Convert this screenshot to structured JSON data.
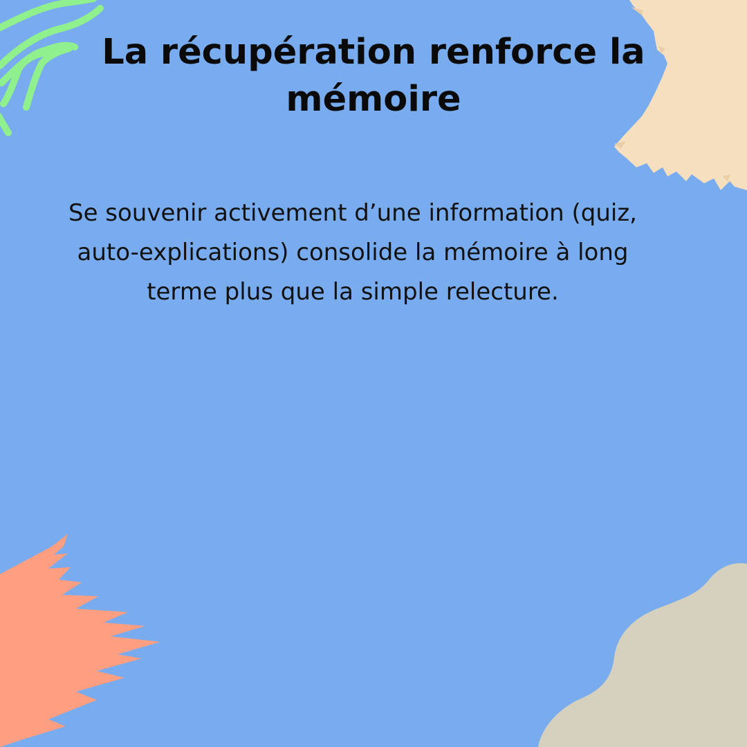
{
  "colors": {
    "background": "#78acee",
    "green_lines": "#8ff08d",
    "peach_brush": "#f5dfbe",
    "salmon_brush": "#ff9e80",
    "beige_blob": "#d6d0be",
    "text": "#0a0a0a"
  },
  "slide": {
    "title": "La récupération renforce la mémoire",
    "body": "Se souvenir activement d’une information (quiz, auto-explications) consolide la mémoire à long terme plus que la simple relecture."
  }
}
